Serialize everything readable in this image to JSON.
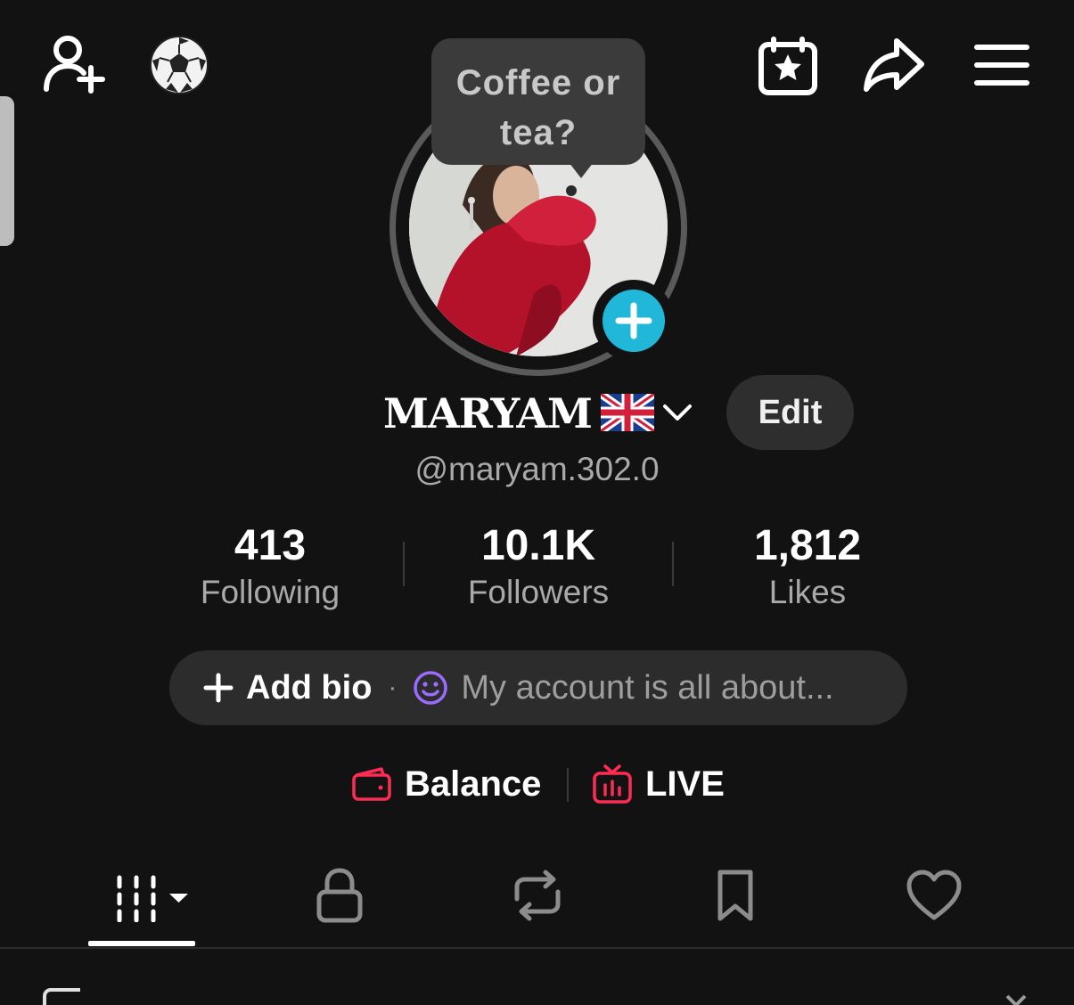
{
  "header": {
    "icons": [
      "add-friend-icon",
      "soccer-ball-icon",
      "calendar-star-icon",
      "share-icon",
      "menu-icon"
    ]
  },
  "profile": {
    "tooltip": "Coffee or tea?",
    "name": "MARYAM",
    "handle": "@maryam.302.0",
    "edit_label": "Edit"
  },
  "stats": [
    {
      "value": "413",
      "label": "Following"
    },
    {
      "value": "10.1K",
      "label": "Followers"
    },
    {
      "value": "1,812",
      "label": "Likes"
    }
  ],
  "bio": {
    "add_label": "Add bio",
    "dot": "·",
    "hint": "My account is all about..."
  },
  "links": {
    "balance": "Balance",
    "live": "LIVE"
  },
  "colors": {
    "background": "#121212",
    "accent_cyan": "#20b7d8",
    "accent_red": "#fe2c55",
    "accent_purple": "#9b6bff"
  }
}
